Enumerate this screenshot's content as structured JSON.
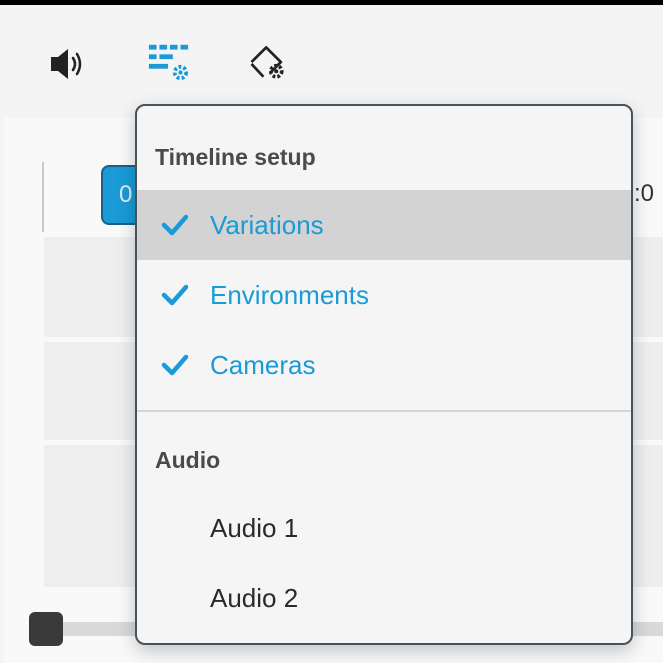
{
  "toolbar": {
    "icons": [
      {
        "name": "speaker-icon"
      },
      {
        "name": "timeline-settings-icon",
        "color": "#1a9ad6"
      },
      {
        "name": "shape-settings-icon"
      }
    ]
  },
  "timeline": {
    "current_time_partial": "0",
    "end_time_partial": ":0"
  },
  "menu": {
    "timeline_header": "Timeline setup",
    "timeline_items": [
      {
        "label": "Variations",
        "checked": true,
        "highlighted": true
      },
      {
        "label": "Environments",
        "checked": true,
        "highlighted": false
      },
      {
        "label": "Cameras",
        "checked": true,
        "highlighted": false
      }
    ],
    "audio_header": "Audio",
    "audio_items": [
      {
        "label": "Audio 1",
        "checked": false
      },
      {
        "label": "Audio 2",
        "checked": false
      }
    ]
  },
  "colors": {
    "accent": "#1a9ad6",
    "menu_border": "#46535c",
    "highlight": "#d3d3d3"
  }
}
